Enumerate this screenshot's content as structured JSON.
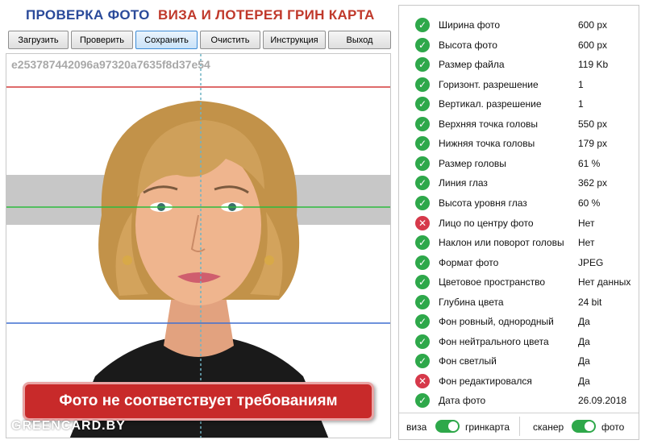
{
  "header": {
    "title_left": "ПРОВЕРКА ФОТО",
    "title_right": "ВИЗА И ЛОТЕРЕЯ ГРИН КАРТА"
  },
  "toolbar": {
    "buttons": [
      "Загрузить",
      "Проверить",
      "Сохранить",
      "Очистить",
      "Инструкция",
      "Выход"
    ]
  },
  "photo": {
    "hash": "e253787442096a97320a7635f8d37e54",
    "banner": "Фото не соответствует требованиям",
    "watermark": "GREENCARD.BY",
    "guide_colors": {
      "top": "#d33a3a",
      "eyes": "#2dbb3f",
      "chin": "#3f6fd0",
      "center": "#6fb3c4"
    }
  },
  "checks": [
    {
      "label": "Ширина фото",
      "value": "600 px",
      "ok": true
    },
    {
      "label": "Высота фото",
      "value": "600 px",
      "ok": true
    },
    {
      "label": "Размер файла",
      "value": "119 Kb",
      "ok": true
    },
    {
      "label": "Горизонт. разрешение",
      "value": "1",
      "ok": true
    },
    {
      "label": "Вертикал. разрешение",
      "value": "1",
      "ok": true
    },
    {
      "label": "Верхняя точка головы",
      "value": "550 px",
      "ok": true
    },
    {
      "label": "Нижняя точка головы",
      "value": "179 px",
      "ok": true
    },
    {
      "label": "Размер головы",
      "value": "61 %",
      "ok": true
    },
    {
      "label": "Линия глаз",
      "value": "362 px",
      "ok": true
    },
    {
      "label": "Высота уровня глаз",
      "value": "60 %",
      "ok": true
    },
    {
      "label": "Лицо по центру фото",
      "value": "Нет",
      "ok": false
    },
    {
      "label": "Наклон или поворот головы",
      "value": "Нет",
      "ok": true
    },
    {
      "label": "Формат фото",
      "value": "JPEG",
      "ok": true
    },
    {
      "label": "Цветовое пространство",
      "value": "Нет данных",
      "ok": true
    },
    {
      "label": "Глубина цвета",
      "value": "24 bit",
      "ok": true
    },
    {
      "label": "Фон ровный, однородный",
      "value": "Да",
      "ok": true
    },
    {
      "label": "Фон нейтрального цвета",
      "value": "Да",
      "ok": true
    },
    {
      "label": "Фон светлый",
      "value": "Да",
      "ok": true
    },
    {
      "label": "Фон редактировался",
      "value": "Да",
      "ok": false
    },
    {
      "label": "Дата фото",
      "value": "26.09.2018",
      "ok": true
    }
  ],
  "toggles": {
    "left": {
      "off_label": "виза",
      "on_label": "гринкарта"
    },
    "right": {
      "off_label": "сканер",
      "on_label": "фото"
    }
  },
  "colors": {
    "ok": "#2ea84a",
    "bad": "#d6394a",
    "accent": "#2a4a9a",
    "alert": "#c82a2a"
  },
  "icons": {
    "ok": "check-circle-icon",
    "bad": "x-circle-icon"
  }
}
